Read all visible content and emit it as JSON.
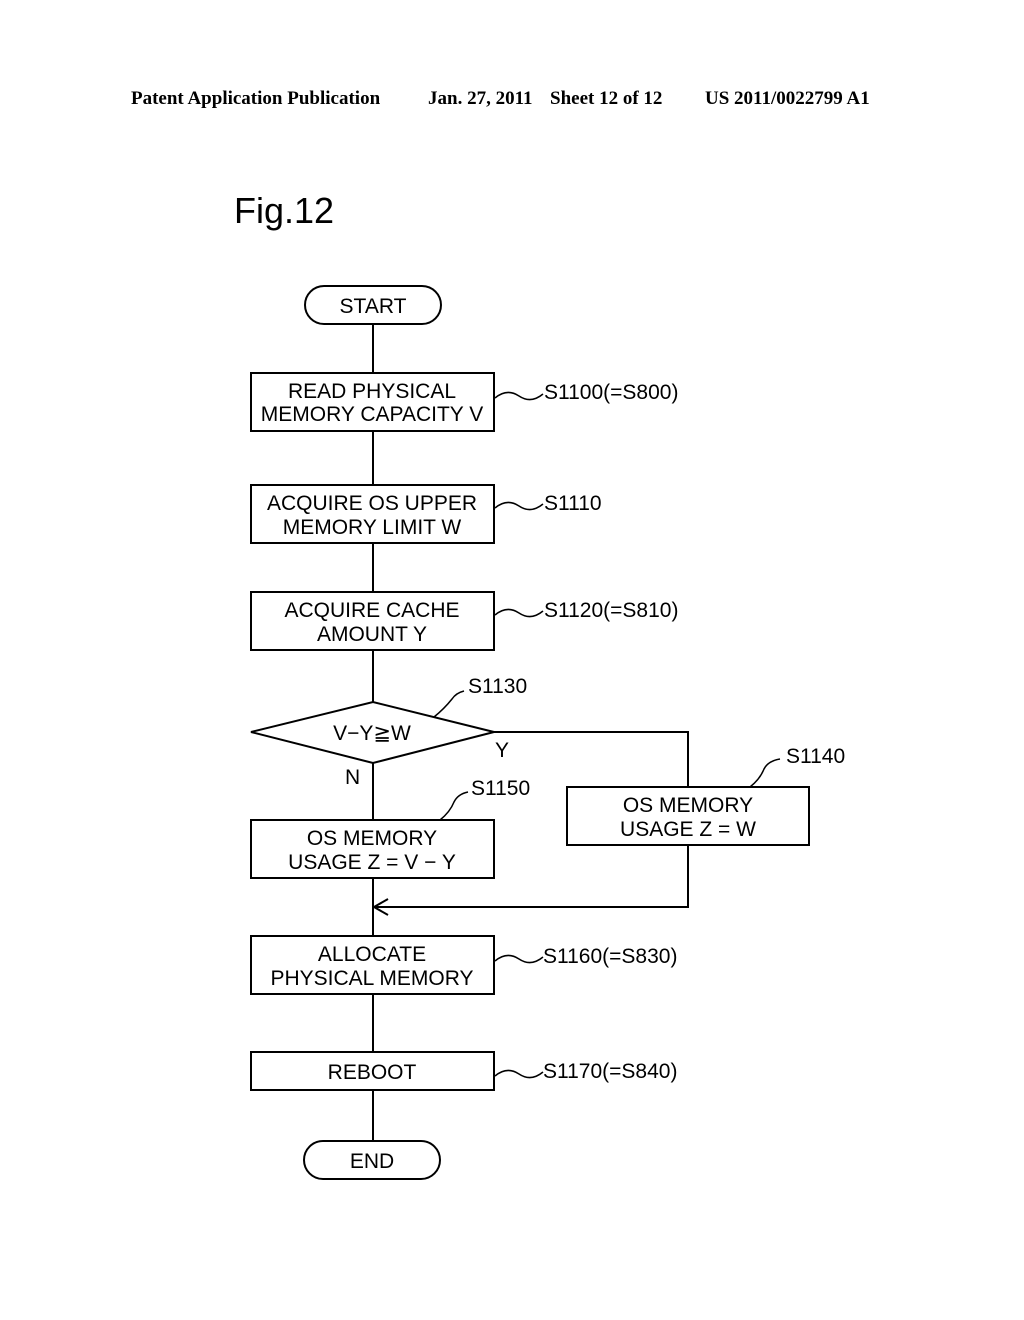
{
  "header": {
    "publication": "Patent Application Publication",
    "date": "Jan. 27, 2011",
    "sheet": "Sheet 12 of 12",
    "number": "US 2011/0022799 A1"
  },
  "figure_label": "Fig.12",
  "flowchart": {
    "start": "START",
    "end": "END",
    "steps": [
      {
        "id": "S1100",
        "ref": "S1100(=S800)",
        "lines": [
          "READ PHYSICAL",
          "MEMORY CAPACITY V"
        ]
      },
      {
        "id": "S1110",
        "ref": "S1110",
        "lines": [
          "ACQUIRE OS UPPER",
          "MEMORY LIMIT W"
        ]
      },
      {
        "id": "S1120",
        "ref": "S1120(=S810)",
        "lines": [
          "ACQUIRE CACHE",
          "AMOUNT Y"
        ]
      },
      {
        "id": "S1130",
        "ref": "S1130",
        "lines": [
          "V−Y≧W"
        ],
        "type": "decision",
        "yes_label": "Y",
        "no_label": "N"
      },
      {
        "id": "S1140",
        "ref": "S1140",
        "lines": [
          "OS MEMORY",
          "USAGE Z = W"
        ]
      },
      {
        "id": "S1150",
        "ref": "S1150",
        "lines": [
          "OS MEMORY",
          "USAGE Z = V − Y"
        ]
      },
      {
        "id": "S1160",
        "ref": "S1160(=S830)",
        "lines": [
          "ALLOCATE",
          "PHYSICAL MEMORY"
        ]
      },
      {
        "id": "S1170",
        "ref": "S1170(=S840)",
        "lines": [
          "REBOOT"
        ]
      }
    ]
  }
}
